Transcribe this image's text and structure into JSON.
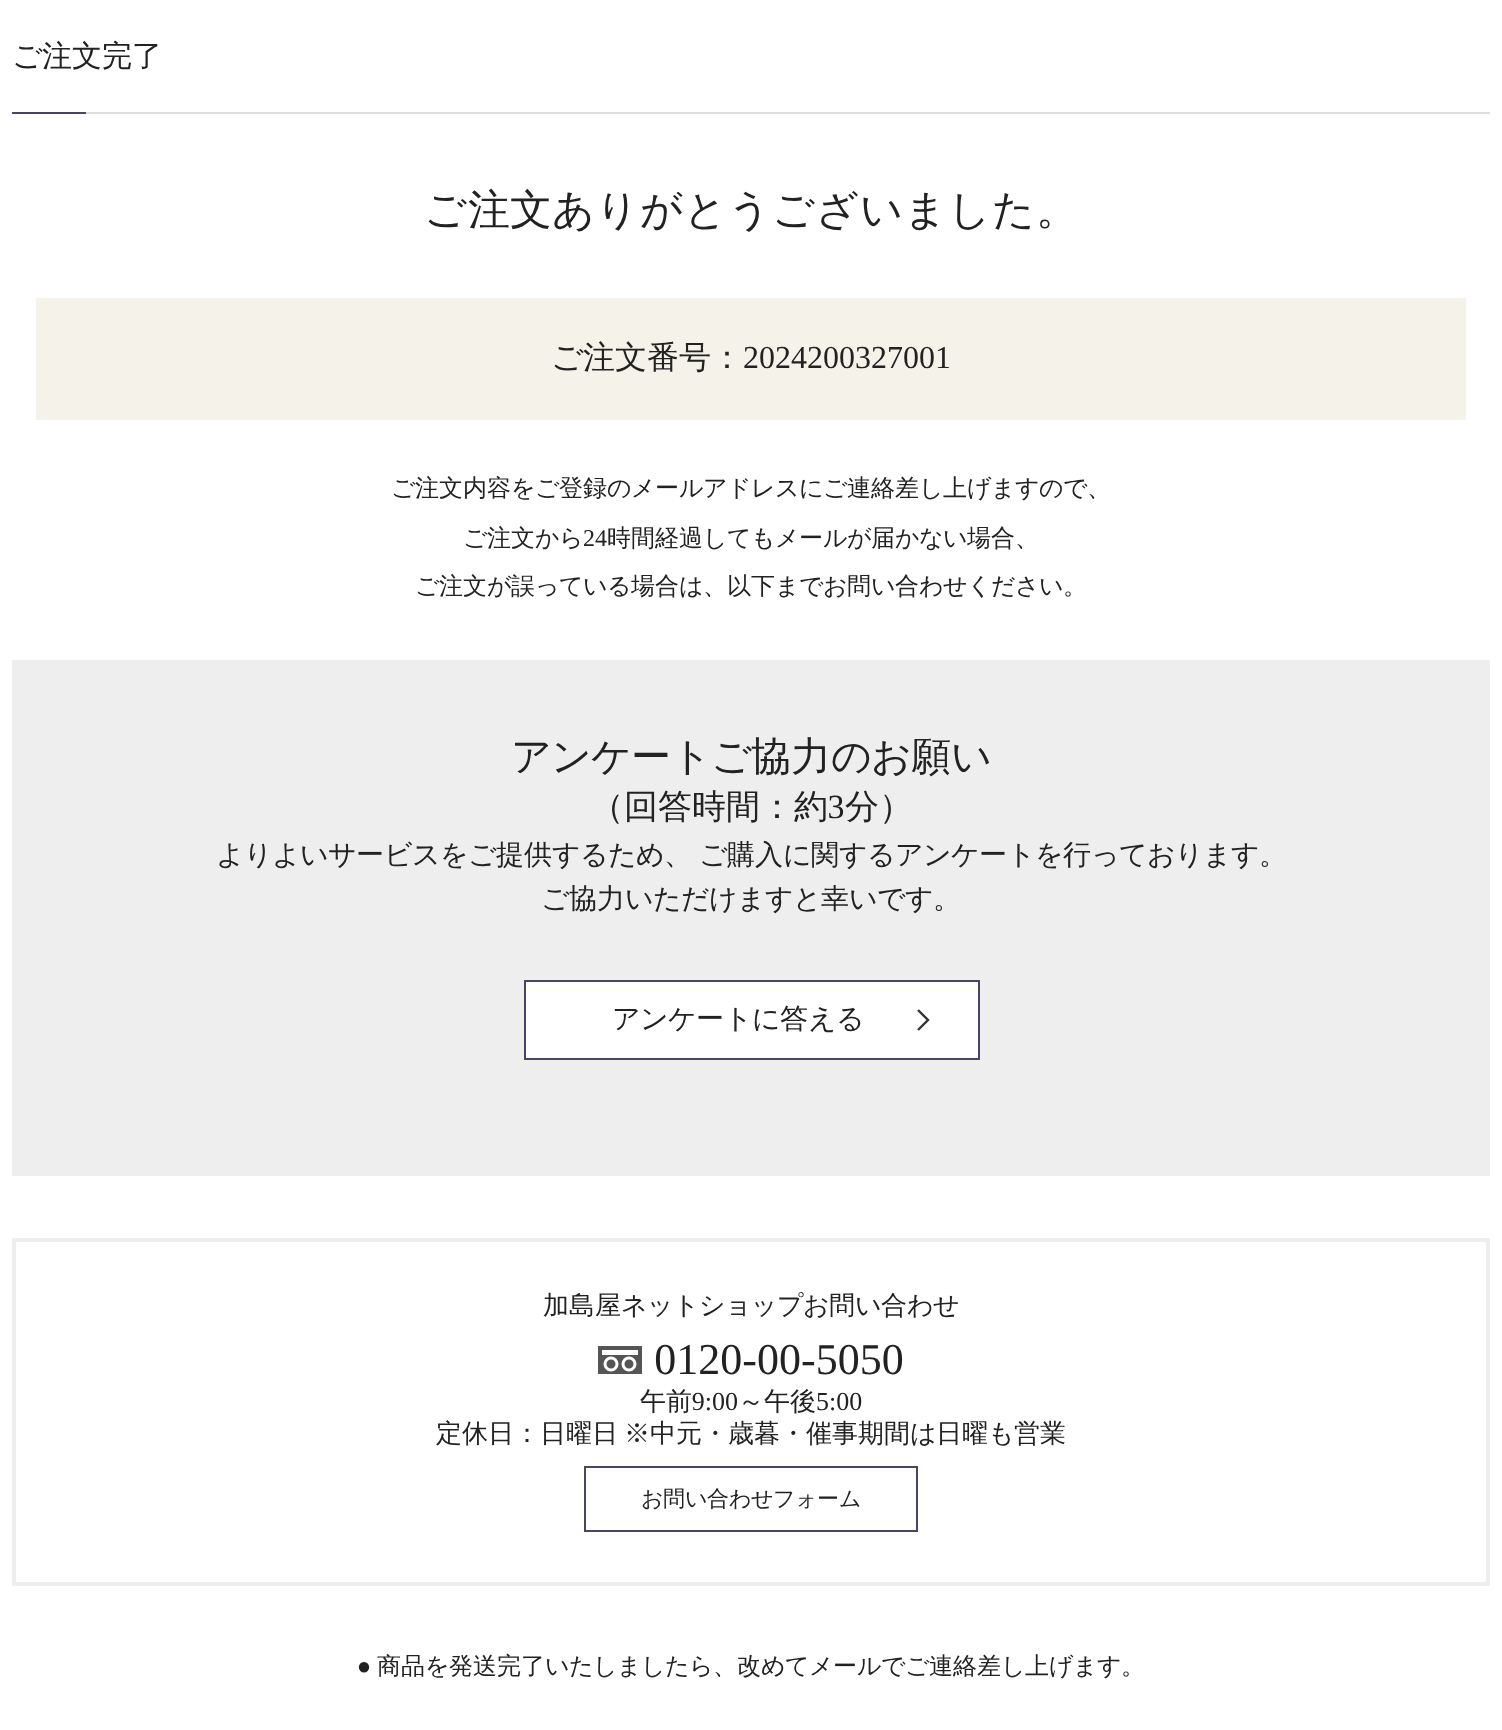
{
  "page_title": "ご注文完了",
  "heading": "ご注文ありがとうございました。",
  "order_number": "ご注文番号：2024200327001",
  "notice_lines": [
    "ご注文内容をご登録のメールアドレスにご連絡差し上げますので、",
    "ご注文から24時間経過してもメールが届かない場合、",
    "ご注文が誤っている場合は、以下までお問い合わせください。"
  ],
  "survey": {
    "title": "アンケートご協力のお願い",
    "subtitle": "（回答時間：約3分）",
    "body_lines": [
      "よりよいサービスをご提供するため、 ご購入に関するアンケートを行っております。",
      "ご協力いただけますと幸いです。"
    ],
    "button": "アンケートに答える"
  },
  "contact": {
    "title": "加島屋ネットショップお問い合わせ",
    "phone": "0120-00-5050",
    "hours": "午前9:00～午後5:00",
    "holidays": "定休日：日曜日  ※中元・歳暮・催事期間は日曜も営業",
    "button": "お問い合わせフォーム"
  },
  "footer_note": "● 商品を発送完了いたしましたら、改めてメールでご連絡差し上げます。"
}
